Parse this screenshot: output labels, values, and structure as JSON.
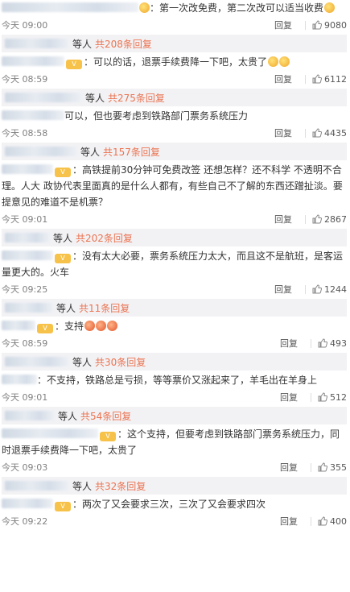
{
  "reply_label": "回复",
  "items": [
    {
      "text": "：第一次改免费，第二次改可以适当收费",
      "time": "今天 09:00",
      "likes": "9080",
      "thread_prefix": "等人",
      "thread_count": "共208条回复"
    },
    {
      "text": "：可以的话，退票手续费降一下吧，太贵了",
      "time": "今天 08:59",
      "likes": "6112",
      "thread_prefix": "等人",
      "thread_count": "共275条回复"
    },
    {
      "text": "可以，但也要考虑到铁路部门票务系统压力",
      "time": "今天 08:58",
      "likes": "4435",
      "thread_prefix": "等人",
      "thread_count": "共157条回复"
    },
    {
      "text": "：高铁提前30分钟可免费改签 还想怎样？还不科学 不透明不合理。人大 政协代表里面真的是什么人都有，有些自己不了解的东西还蹭扯淡。要提意见的难道不是机票？",
      "time": "今天 09:01",
      "likes": "2867",
      "thread_prefix": "等人",
      "thread_count": "共202条回复"
    },
    {
      "text": "：没有太大必要，票务系统压力太大，而且这不是航班，是客运量更大的。火车",
      "time": "今天 09:25",
      "likes": "1244",
      "thread_prefix": "等人",
      "thread_count": "共11条回复"
    },
    {
      "text": "：支持",
      "time": "今天 08:59",
      "likes": "493",
      "thread_prefix": "等人",
      "thread_count": "共30条回复"
    },
    {
      "text": "：不支持，铁路总是亏损，等等票价又涨起来了，羊毛出在羊身上",
      "time": "今天 09:01",
      "likes": "512",
      "thread_prefix": "等人",
      "thread_count": "共54条回复"
    },
    {
      "text": "：这个支持，但要考虑到铁路部门票务系统压力，同时退票手续费降一下吧，太贵了",
      "time": "今天 09:03",
      "likes": "355",
      "thread_prefix": "等人",
      "thread_count": "共32条回复"
    },
    {
      "text": "：两次了又会要求三次，三次了又会要求四次",
      "time": "今天 09:22",
      "likes": "400"
    }
  ]
}
